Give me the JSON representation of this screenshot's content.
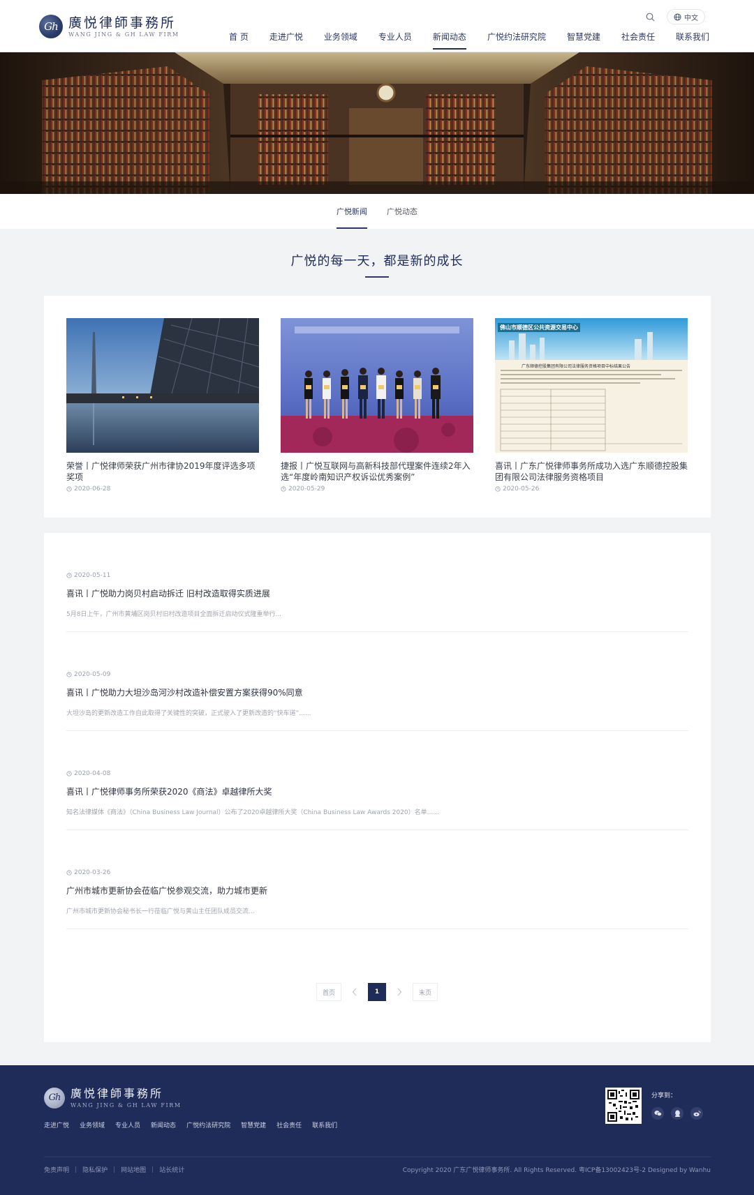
{
  "header": {
    "logo_cn": "廣悦律師事務所",
    "logo_en": "WANG JING & GH LAW FIRM",
    "logo_mark": "Gh",
    "lang": "中文",
    "nav": [
      "首 页",
      "走进广悦",
      "业务领域",
      "专业人员",
      "新闻动态",
      "广悦约法研究院",
      "智慧党建",
      "社会责任",
      "联系我们"
    ],
    "active_nav": 4
  },
  "subtabs": [
    "广悦新闻",
    "广悦动态"
  ],
  "section_title": "广悦的每一天，都是新的成长",
  "featured": [
    {
      "title": "荣誉丨广悦律师荣获广州市律协2019年度评选多项奖项",
      "date": "2020-06-28"
    },
    {
      "title": "捷报丨广悦互联网与高新科技部代理案件连续2年入选“年度岭南知识产权诉讼优秀案例”",
      "date": "2020-05-29"
    },
    {
      "title": "喜讯丨广东广悦律师事务所成功入选广东顺德控股集团有限公司法律服务资格项目",
      "date": "2020-05-26"
    }
  ],
  "featured_img3_banner": "佛山市顺德区公共资源交易中心",
  "featured_img3_doc": "广东顺德控股集团有限公司法律服务资格项目中标结果公告",
  "list": [
    {
      "date": "2020-05-11",
      "title": "喜讯丨广悦助力岗贝村启动拆迁 旧村改造取得实质进展",
      "summary": "5月8日上午，广州市黄埔区岗贝村旧村改造项目全面拆迁启动仪式隆重举行..."
    },
    {
      "date": "2020-05-09",
      "title": "喜讯丨广悦助力大坦沙岛河沙村改造补偿安置方案获得90%同意",
      "summary": "大坦沙岛的更新改造工作自此取得了关键性的突破，正式驶入了更新改造的“快车道”......"
    },
    {
      "date": "2020-04-08",
      "title": "喜讯丨广悦律师事务所荣获2020《商法》卓越律所大奖",
      "summary": "知名法律媒体《商法》（China Business Law Journal）公布了2020卓越律所大奖（China Business Law Awards 2020）名单......"
    },
    {
      "date": "2020-03-26",
      "title": "广州市城市更新协会莅临广悦参观交流，助力城市更新",
      "summary": "广州市城市更新协会秘书长一行莅临广悦与黄山主任团队成员交流..."
    }
  ],
  "pagination": {
    "first": "首页",
    "current": "1",
    "last": "末页"
  },
  "footer": {
    "logo_cn": "廣悦律師事務所",
    "logo_en": "WANG JING & GH LAW FIRM",
    "nav": [
      "走进广悦",
      "业务领域",
      "专业人员",
      "新闻动态",
      "广悦约法研究院",
      "智慧党建",
      "社会责任",
      "联系我们"
    ],
    "share_label": "分享到：",
    "links": [
      "免责声明",
      "隐私保护",
      "网站地图",
      "站长统计"
    ],
    "copyright": "Copyright 2020 广东广悦律师事务所. All Rights Reserved.   粤ICP备13002423号-2   Designed by Wanhu"
  },
  "colors": {
    "brand": "#1f2b59",
    "background": "#f2f3f5"
  }
}
